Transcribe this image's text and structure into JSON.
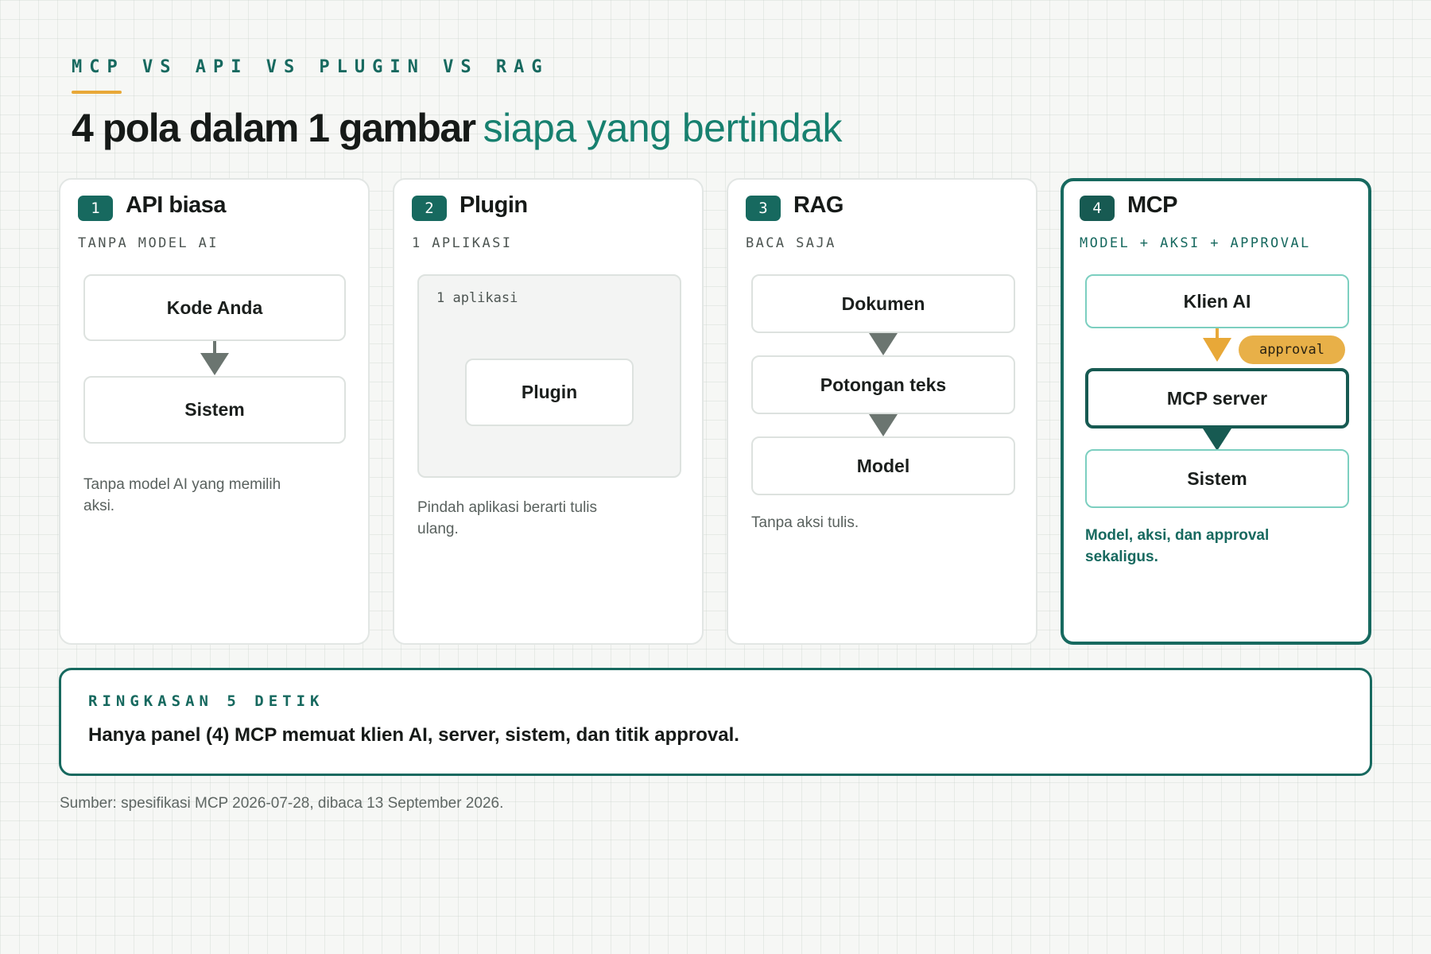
{
  "header": {
    "eyebrow": "MCP VS API VS PLUGIN VS RAG",
    "title_main": "4 pola dalam 1 gambar",
    "title_accent": "siapa yang bertindak"
  },
  "panels": [
    {
      "number": "1",
      "title": "API biasa",
      "subtitle": "TANPA MODEL AI",
      "boxes": [
        "Kode Anda",
        "Sistem"
      ],
      "note": "Tanpa model AI yang memilih aksi."
    },
    {
      "number": "2",
      "title": "Plugin",
      "subtitle": "1 APLIKASI",
      "group_label": "1 aplikasi",
      "boxes": [
        "Plugin"
      ],
      "note": "Pindah aplikasi berarti tulis ulang."
    },
    {
      "number": "3",
      "title": "RAG",
      "subtitle": "BACA SAJA",
      "boxes": [
        "Dokumen",
        "Potongan teks",
        "Model"
      ],
      "note": "Tanpa aksi tulis."
    },
    {
      "number": "4",
      "title": "MCP",
      "subtitle": "MODEL + AKSI + APPROVAL",
      "boxes": [
        "Klien AI",
        "MCP server",
        "Sistem"
      ],
      "approval_label": "approval",
      "note": "Model, aksi, dan approval sekaligus."
    }
  ],
  "summary": {
    "label": "RINGKASAN 5 DETIK",
    "text": "Hanya panel (4) MCP memuat klien AI, server, sistem, dan titik approval."
  },
  "source": "Sumber: spesifikasi MCP 2026-07-28, dibaca 13 September 2026.",
  "colors": {
    "teal_dark": "#175a52",
    "teal": "#17695f",
    "teal_light": "#7ccfc0",
    "accent_amber": "#e8a838",
    "arrow_gray": "#6b7570"
  },
  "icons": {
    "arrow": "down-triangle"
  }
}
